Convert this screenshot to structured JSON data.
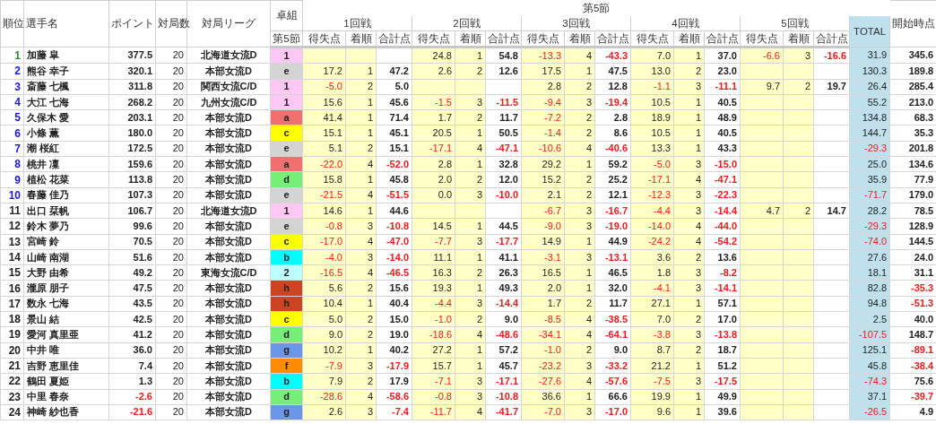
{
  "header": {
    "rank": "順位",
    "name": "選手名",
    "points": "ポイント",
    "games": "対局数",
    "league": "対局リーグ",
    "group": "卓組",
    "group_sub": "第5節",
    "section": "第5節",
    "rounds": [
      {
        "label": "1回戦",
        "sub": [
          "得失点",
          "着順",
          "合計点"
        ]
      },
      {
        "label": "2回戦",
        "sub": [
          "得失点",
          "着順",
          "合計点"
        ]
      },
      {
        "label": "3回戦",
        "sub": [
          "得失点",
          "着順",
          "合計点"
        ]
      },
      {
        "label": "4回戦",
        "sub": [
          "得失点",
          "着順",
          "合計点"
        ]
      },
      {
        "label": "5回戦",
        "sub": [
          "得失点",
          "着順",
          "合計点"
        ]
      }
    ],
    "total": "TOTAL",
    "start": "開始時点"
  },
  "rows": [
    {
      "rank": "1",
      "color": "#2e8b3a",
      "name": "加藤 皐",
      "points": "377.5",
      "games": "20",
      "league": "北海道女流D",
      "group": {
        "label": "1",
        "color": "#ffc8f4"
      },
      "round_2": {
        "score": "24.8",
        "place": "1",
        "sum": "54.8"
      },
      "round_3": {
        "score": "-13.3",
        "place": "4",
        "sum": "-43.3"
      },
      "round_4": {
        "score": "7.0",
        "place": "1",
        "sum": "37.0"
      },
      "round_5": {
        "score": "-6.6",
        "place": "3",
        "sum": "-16.6"
      },
      "total": "31.9",
      "start": "345.6"
    },
    {
      "rank": "2",
      "color": "#1a1adc",
      "name": "熊谷 幸子",
      "points": "320.1",
      "games": "20",
      "league": "本部女流D",
      "group": {
        "label": "e",
        "color": "#d4d4d4"
      },
      "round_1": {
        "score": "17.2",
        "place": "1",
        "sum": "47.2"
      },
      "round_2": {
        "score": "2.6",
        "place": "2",
        "sum": "12.6"
      },
      "round_3": {
        "score": "17.5",
        "place": "1",
        "sum": "47.5"
      },
      "round_4": {
        "score": "13.0",
        "place": "2",
        "sum": "23.0"
      },
      "total": "130.3",
      "start": "189.8"
    },
    {
      "rank": "3",
      "color": "#1a1adc",
      "name": "斎藤 七楓",
      "points": "311.8",
      "games": "20",
      "league": "関西女流C/D",
      "group": {
        "label": "1",
        "color": "#ffc8f4"
      },
      "round_1": {
        "score": "-5.0",
        "place": "2",
        "sum": "5.0"
      },
      "round_3": {
        "score": "2.8",
        "place": "2",
        "sum": "12.8"
      },
      "round_4": {
        "score": "-1.1",
        "place": "3",
        "sum": "-11.1"
      },
      "round_5": {
        "score": "9.7",
        "place": "2",
        "sum": "19.7"
      },
      "total": "26.4",
      "start": "285.4"
    },
    {
      "rank": "4",
      "color": "#1a1adc",
      "name": "大江 七海",
      "points": "268.2",
      "games": "20",
      "league": "九州女流C/D",
      "group": {
        "label": "1",
        "color": "#ffc8f4"
      },
      "round_1": {
        "score": "15.6",
        "place": "1",
        "sum": "45.6"
      },
      "round_2": {
        "score": "-1.5",
        "place": "3",
        "sum": "-11.5"
      },
      "round_3": {
        "score": "-9.4",
        "place": "3",
        "sum": "-19.4"
      },
      "round_4": {
        "score": "10.5",
        "place": "1",
        "sum": "40.5"
      },
      "total": "55.2",
      "start": "213.0"
    },
    {
      "rank": "5",
      "color": "#1a1adc",
      "name": "久保木 愛",
      "points": "203.1",
      "games": "20",
      "league": "本部女流D",
      "group": {
        "label": "a",
        "color": "#f07070"
      },
      "round_1": {
        "score": "41.4",
        "place": "1",
        "sum": "71.4"
      },
      "round_2": {
        "score": "1.7",
        "place": "2",
        "sum": "11.7"
      },
      "round_3": {
        "score": "-7.2",
        "place": "2",
        "sum": "2.8"
      },
      "round_4": {
        "score": "18.9",
        "place": "1",
        "sum": "48.9"
      },
      "total": "134.8",
      "start": "68.3"
    },
    {
      "rank": "6",
      "color": "#1a1adc",
      "name": "小條 薫",
      "points": "180.0",
      "games": "20",
      "league": "本部女流D",
      "group": {
        "label": "c",
        "color": "#ffff00"
      },
      "round_1": {
        "score": "15.1",
        "place": "1",
        "sum": "45.1"
      },
      "round_2": {
        "score": "20.5",
        "place": "1",
        "sum": "50.5"
      },
      "round_3": {
        "score": "-1.4",
        "place": "2",
        "sum": "8.6"
      },
      "round_4": {
        "score": "10.5",
        "place": "1",
        "sum": "40.5"
      },
      "total": "144.7",
      "start": "35.3"
    },
    {
      "rank": "7",
      "color": "#1a1adc",
      "name": "潮 桜紅",
      "points": "172.5",
      "games": "20",
      "league": "本部女流D",
      "group": {
        "label": "e",
        "color": "#d4d4d4"
      },
      "round_1": {
        "score": "5.1",
        "place": "2",
        "sum": "15.1"
      },
      "round_2": {
        "score": "-17.1",
        "place": "4",
        "sum": "-47.1"
      },
      "round_3": {
        "score": "-10.6",
        "place": "4",
        "sum": "-40.6"
      },
      "round_4": {
        "score": "13.3",
        "place": "1",
        "sum": "43.3"
      },
      "total": "-29.3",
      "start": "201.8"
    },
    {
      "rank": "8",
      "color": "#1a1adc",
      "name": "桃井 凜",
      "points": "159.6",
      "games": "20",
      "league": "本部女流D",
      "group": {
        "label": "a",
        "color": "#f07070"
      },
      "round_1": {
        "score": "-22.0",
        "place": "4",
        "sum": "-52.0"
      },
      "round_2": {
        "score": "2.8",
        "place": "1",
        "sum": "32.8"
      },
      "round_3": {
        "score": "29.2",
        "place": "1",
        "sum": "59.2"
      },
      "round_4": {
        "score": "-5.0",
        "place": "3",
        "sum": "-15.0"
      },
      "total": "25.0",
      "start": "134.6"
    },
    {
      "rank": "9",
      "color": "#1a1adc",
      "name": "植松 花菜",
      "points": "113.8",
      "games": "20",
      "league": "本部女流D",
      "group": {
        "label": "d",
        "color": "#77ee77"
      },
      "round_1": {
        "score": "15.8",
        "place": "1",
        "sum": "45.8"
      },
      "round_2": {
        "score": "2.0",
        "place": "2",
        "sum": "12.0"
      },
      "round_3": {
        "score": "15.2",
        "place": "2",
        "sum": "25.2"
      },
      "round_4": {
        "score": "-17.1",
        "place": "4",
        "sum": "-47.1"
      },
      "total": "35.9",
      "start": "77.9"
    },
    {
      "rank": "10",
      "color": "#1a1adc",
      "name": "春藤 佳乃",
      "points": "107.3",
      "games": "20",
      "league": "本部女流D",
      "group": {
        "label": "e",
        "color": "#d4d4d4"
      },
      "round_1": {
        "score": "-21.5",
        "place": "4",
        "sum": "-51.5"
      },
      "round_2": {
        "score": "0.0",
        "place": "3",
        "sum": "-10.0"
      },
      "round_3": {
        "score": "2.1",
        "place": "2",
        "sum": "12.1"
      },
      "round_4": {
        "score": "-12.3",
        "place": "3",
        "sum": "-22.3"
      },
      "total": "-71.7",
      "start": "179.0"
    },
    {
      "rank": "11",
      "color": "#222222",
      "name": "出口 栞帆",
      "points": "106.7",
      "games": "20",
      "league": "北海道女流D",
      "group": {
        "label": "1",
        "color": "#ffc8f4"
      },
      "round_1": {
        "score": "14.6",
        "place": "1",
        "sum": "44.6"
      },
      "round_3": {
        "score": "-6.7",
        "place": "3",
        "sum": "-16.7"
      },
      "round_4": {
        "score": "-4.4",
        "place": "3",
        "sum": "-14.4"
      },
      "round_5": {
        "score": "4.7",
        "place": "2",
        "sum": "14.7"
      },
      "total": "28.2",
      "start": "78.5"
    },
    {
      "rank": "12",
      "color": "#222222",
      "name": "鈴木 夢乃",
      "points": "99.6",
      "games": "20",
      "league": "本部女流D",
      "group": {
        "label": "e",
        "color": "#d4d4d4"
      },
      "round_1": {
        "score": "-0.8",
        "place": "3",
        "sum": "-10.8"
      },
      "round_2": {
        "score": "14.5",
        "place": "1",
        "sum": "44.5"
      },
      "round_3": {
        "score": "-9.0",
        "place": "3",
        "sum": "-19.0"
      },
      "round_4": {
        "score": "-14.0",
        "place": "4",
        "sum": "-44.0"
      },
      "total": "-29.3",
      "start": "128.9"
    },
    {
      "rank": "13",
      "color": "#222222",
      "name": "宮崎 鈴",
      "points": "70.5",
      "games": "20",
      "league": "本部女流D",
      "group": {
        "label": "c",
        "color": "#ffff00"
      },
      "round_1": {
        "score": "-17.0",
        "place": "4",
        "sum": "-47.0"
      },
      "round_2": {
        "score": "-7.7",
        "place": "3",
        "sum": "-17.7"
      },
      "round_3": {
        "score": "14.9",
        "place": "1",
        "sum": "44.9"
      },
      "round_4": {
        "score": "-24.2",
        "place": "4",
        "sum": "-54.2"
      },
      "total": "-74.0",
      "start": "144.5"
    },
    {
      "rank": "14",
      "color": "#222222",
      "name": "山崎 南湖",
      "points": "51.6",
      "games": "20",
      "league": "本部女流D",
      "group": {
        "label": "b",
        "color": "#00ffff"
      },
      "round_1": {
        "score": "-4.0",
        "place": "3",
        "sum": "-14.0"
      },
      "round_2": {
        "score": "11.1",
        "place": "1",
        "sum": "41.1"
      },
      "round_3": {
        "score": "-3.1",
        "place": "3",
        "sum": "-13.1"
      },
      "round_4": {
        "score": "3.6",
        "place": "2",
        "sum": "13.6"
      },
      "total": "27.6",
      "start": "24.0"
    },
    {
      "rank": "15",
      "color": "#222222",
      "name": "大野 由希",
      "points": "49.2",
      "games": "20",
      "league": "東海女流C/D",
      "group": {
        "label": "2",
        "color": "#bbffff"
      },
      "round_1": {
        "score": "-16.5",
        "place": "4",
        "sum": "-46.5"
      },
      "round_2": {
        "score": "16.3",
        "place": "2",
        "sum": "26.3"
      },
      "round_3": {
        "score": "16.5",
        "place": "1",
        "sum": "46.5"
      },
      "round_4": {
        "score": "1.8",
        "place": "3",
        "sum": "-8.2"
      },
      "total": "18.1",
      "start": "31.1"
    },
    {
      "rank": "16",
      "color": "#222222",
      "name": "瀧原 朋子",
      "points": "47.5",
      "games": "20",
      "league": "本部女流D",
      "group": {
        "label": "h",
        "color": "#cc4422"
      },
      "round_1": {
        "score": "5.6",
        "place": "2",
        "sum": "15.6"
      },
      "round_2": {
        "score": "19.3",
        "place": "1",
        "sum": "49.3"
      },
      "round_3": {
        "score": "2.0",
        "place": "1",
        "sum": "32.0"
      },
      "round_4": {
        "score": "-4.1",
        "place": "3",
        "sum": "-14.1"
      },
      "total": "82.8",
      "start": "-35.3"
    },
    {
      "rank": "17",
      "color": "#222222",
      "name": "数永 七海",
      "points": "43.5",
      "games": "20",
      "league": "本部女流D",
      "group": {
        "label": "h",
        "color": "#cc4422"
      },
      "round_1": {
        "score": "10.4",
        "place": "1",
        "sum": "40.4"
      },
      "round_2": {
        "score": "-4.4",
        "place": "3",
        "sum": "-14.4"
      },
      "round_3": {
        "score": "1.7",
        "place": "2",
        "sum": "11.7"
      },
      "round_4": {
        "score": "27.1",
        "place": "1",
        "sum": "57.1"
      },
      "total": "94.8",
      "start": "-51.3"
    },
    {
      "rank": "18",
      "color": "#222222",
      "name": "景山 結",
      "points": "42.5",
      "games": "20",
      "league": "本部女流D",
      "group": {
        "label": "c",
        "color": "#ffff00"
      },
      "round_1": {
        "score": "5.0",
        "place": "2",
        "sum": "15.0"
      },
      "round_2": {
        "score": "-1.0",
        "place": "2",
        "sum": "9.0"
      },
      "round_3": {
        "score": "-8.5",
        "place": "4",
        "sum": "-38.5"
      },
      "round_4": {
        "score": "7.0",
        "place": "2",
        "sum": "17.0"
      },
      "total": "2.5",
      "start": "40.0"
    },
    {
      "rank": "19",
      "color": "#222222",
      "name": "愛河 真里亜",
      "points": "41.2",
      "games": "20",
      "league": "本部女流D",
      "group": {
        "label": "d",
        "color": "#77ee77"
      },
      "round_1": {
        "score": "9.0",
        "place": "2",
        "sum": "19.0"
      },
      "round_2": {
        "score": "-18.6",
        "place": "4",
        "sum": "-48.6"
      },
      "round_3": {
        "score": "-34.1",
        "place": "4",
        "sum": "-64.1"
      },
      "round_4": {
        "score": "-3.8",
        "place": "3",
        "sum": "-13.8"
      },
      "total": "-107.5",
      "start": "148.7"
    },
    {
      "rank": "20",
      "color": "#222222",
      "name": "中井 唯",
      "points": "36.0",
      "games": "20",
      "league": "本部女流D",
      "group": {
        "label": "g",
        "color": "#6c96e8"
      },
      "round_1": {
        "score": "10.2",
        "place": "1",
        "sum": "40.2"
      },
      "round_2": {
        "score": "27.2",
        "place": "1",
        "sum": "57.2"
      },
      "round_3": {
        "score": "-1.0",
        "place": "2",
        "sum": "9.0"
      },
      "round_4": {
        "score": "8.7",
        "place": "2",
        "sum": "18.7"
      },
      "total": "125.1",
      "start": "-89.1"
    },
    {
      "rank": "21",
      "color": "#222222",
      "name": "吉野 恵里佳",
      "points": "7.4",
      "games": "20",
      "league": "本部女流D",
      "group": {
        "label": "f",
        "color": "#ff8c00"
      },
      "round_1": {
        "score": "-7.9",
        "place": "3",
        "sum": "-17.9"
      },
      "round_2": {
        "score": "15.7",
        "place": "1",
        "sum": "45.7"
      },
      "round_3": {
        "score": "-23.2",
        "place": "3",
        "sum": "-33.2"
      },
      "round_4": {
        "score": "21.2",
        "place": "1",
        "sum": "51.2"
      },
      "total": "45.8",
      "start": "-38.4"
    },
    {
      "rank": "22",
      "color": "#222222",
      "name": "鶴田 夏姫",
      "points": "1.3",
      "games": "20",
      "league": "本部女流D",
      "group": {
        "label": "b",
        "color": "#00ffff"
      },
      "round_1": {
        "score": "7.9",
        "place": "2",
        "sum": "17.9"
      },
      "round_2": {
        "score": "-7.1",
        "place": "3",
        "sum": "-17.1"
      },
      "round_3": {
        "score": "-27.6",
        "place": "4",
        "sum": "-57.6"
      },
      "round_4": {
        "score": "-7.5",
        "place": "3",
        "sum": "-17.5"
      },
      "total": "-74.3",
      "start": "75.6"
    },
    {
      "rank": "23",
      "color": "#222222",
      "name": "中里 春奈",
      "points": "-2.6",
      "games": "20",
      "league": "本部女流D",
      "group": {
        "label": "d",
        "color": "#77ee77"
      },
      "round_1": {
        "score": "-28.6",
        "place": "4",
        "sum": "-58.6"
      },
      "round_2": {
        "score": "-0.8",
        "place": "3",
        "sum": "-10.8"
      },
      "round_3": {
        "score": "36.6",
        "place": "1",
        "sum": "66.6"
      },
      "round_4": {
        "score": "19.9",
        "place": "1",
        "sum": "49.9"
      },
      "total": "37.1",
      "start": "-39.7"
    },
    {
      "rank": "24",
      "color": "#222222",
      "name": "神崎 紗也香",
      "points": "-21.6",
      "games": "20",
      "league": "本部女流D",
      "group": {
        "label": "g",
        "color": "#6c96e8"
      },
      "round_1": {
        "score": "2.6",
        "place": "3",
        "sum": "-7.4"
      },
      "round_2": {
        "score": "-11.7",
        "place": "4",
        "sum": "-41.7"
      },
      "round_3": {
        "score": "-7.0",
        "place": "3",
        "sum": "-17.0"
      },
      "round_4": {
        "score": "9.6",
        "place": "1",
        "sum": "39.6"
      },
      "total": "-26.5",
      "start": "4.9"
    }
  ]
}
